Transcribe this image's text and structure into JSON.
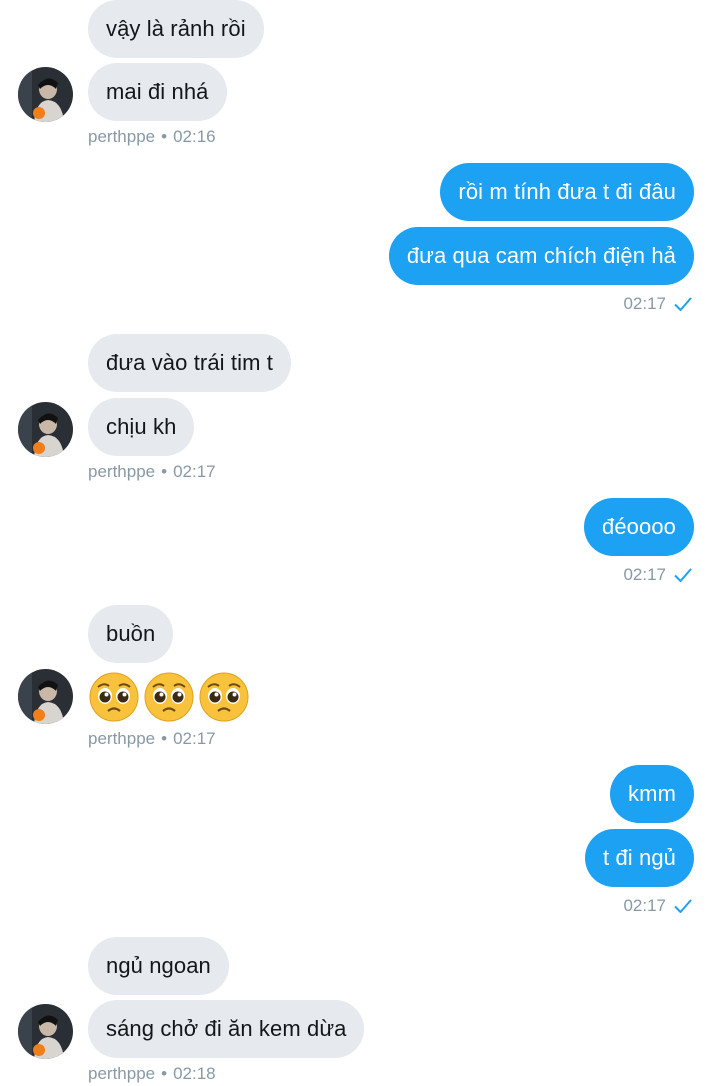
{
  "conversation": {
    "groups": [
      {
        "messages": [
          "vậy là rảnh rồi",
          "mai đi nhá"
        ],
        "sender": "perthppe",
        "time": "02:16"
      },
      {
        "messages": [
          "rồi m tính đưa t đi đâu",
          "đưa qua cam chích điện hả"
        ],
        "time": "02:17"
      },
      {
        "messages": [
          "đưa vào trái tim t",
          "chịu kh"
        ],
        "sender": "perthppe",
        "time": "02:17"
      },
      {
        "messages": [
          "đéoooo"
        ],
        "time": "02:17"
      },
      {
        "messages": [
          "buồn"
        ],
        "emoji": "pleading-face",
        "emoji_count": 3,
        "sender": "perthppe",
        "time": "02:17"
      },
      {
        "messages": [
          "kmm",
          "t đi ngủ"
        ],
        "time": "02:17"
      },
      {
        "messages": [
          "ngủ ngoan",
          "sáng chở đi ăn kem dừa"
        ],
        "sender": "perthppe",
        "time": "02:18"
      }
    ],
    "separator": "•"
  },
  "colors": {
    "outgoing_bubble": "#1da1f2",
    "incoming_bubble": "#e6e9ed",
    "meta_text": "#8899a6",
    "read_check": "#1da1f2"
  },
  "icons": {
    "read_receipt": "check-icon",
    "avatar": "user-avatar"
  }
}
